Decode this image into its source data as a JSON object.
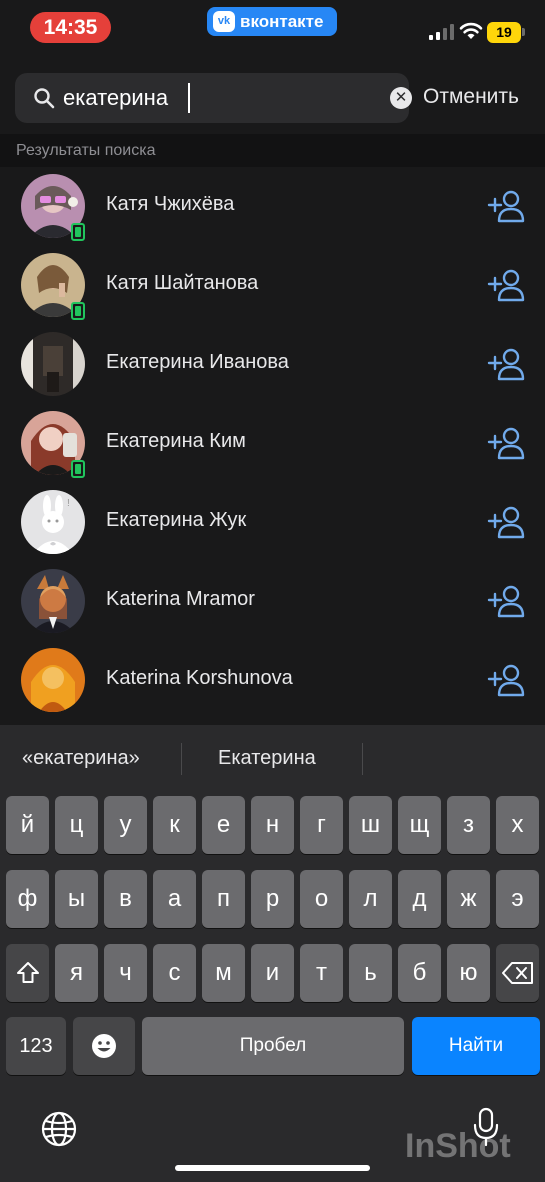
{
  "status_bar": {
    "time": "14:35",
    "app_badge": "вконтакте",
    "app_badge_logo": "vk",
    "battery": "19",
    "icons": [
      "signal-icon",
      "wifi-icon",
      "battery-icon"
    ]
  },
  "search": {
    "value": "екатерина",
    "cancel_label": "Отменить",
    "icon": "search-icon",
    "clear_icon": "clear-icon"
  },
  "section_title": "Результаты поиска",
  "results": [
    {
      "name": "Катя Чжихёва",
      "online": true
    },
    {
      "name": "Катя Шайтанова",
      "online": true
    },
    {
      "name": "Екатерина Иванова",
      "online": false
    },
    {
      "name": "Екатерина Ким",
      "online": true
    },
    {
      "name": "Екатерина Жук",
      "online": false
    },
    {
      "name": "Katerina Mramor",
      "online": false
    },
    {
      "name": "Katerina Korshunova",
      "online": false
    }
  ],
  "keyboard": {
    "suggestions": [
      "«екатерина»",
      "Екатерина"
    ],
    "row1": [
      "й",
      "ц",
      "у",
      "к",
      "е",
      "н",
      "г",
      "ш",
      "щ",
      "з",
      "х"
    ],
    "row2": [
      "ф",
      "ы",
      "в",
      "а",
      "п",
      "р",
      "о",
      "л",
      "д",
      "ж",
      "э"
    ],
    "row3": [
      "я",
      "ч",
      "с",
      "м",
      "и",
      "т",
      "ь",
      "б",
      "ю"
    ],
    "numbers_label": "123",
    "space_label": "Пробел",
    "action_label": "Найти",
    "emoji_icon": "emoji-icon",
    "shift_icon": "shift-icon",
    "backspace_icon": "backspace-icon",
    "globe_icon": "globe-icon",
    "mic_icon": "mic-icon"
  },
  "watermark": "InShot",
  "colors": {
    "background": "#19191a",
    "accent": "#2787f5",
    "online": "#21c55d",
    "time_pill": "#e5403a",
    "battery": "#ffd60a",
    "add_icon": "#71aaeb",
    "action_key": "#0a84ff"
  }
}
